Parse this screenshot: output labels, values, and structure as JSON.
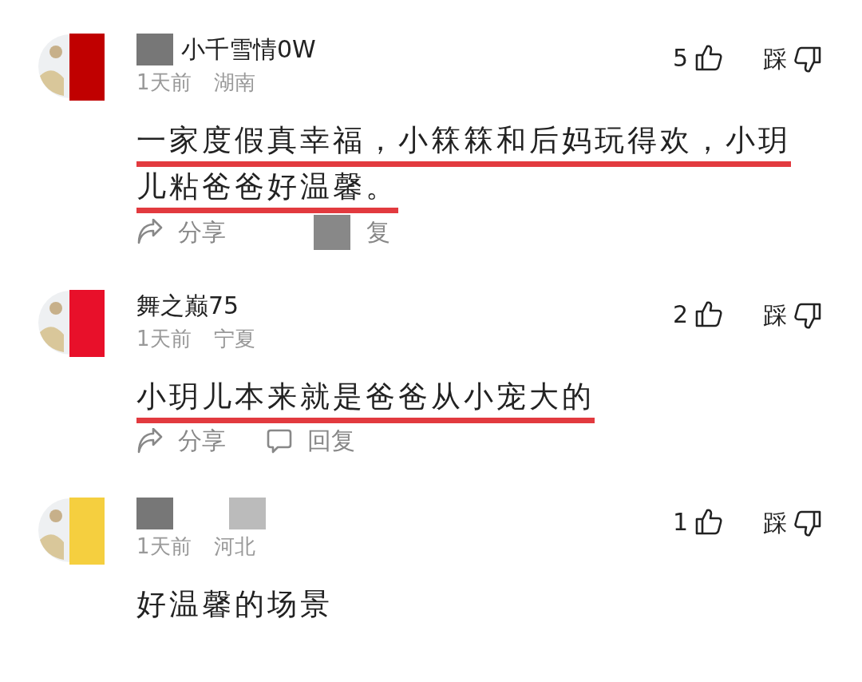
{
  "comments": [
    {
      "avatar": {
        "color": "#c00000"
      },
      "name": "小千雪情0W",
      "name_redacted": true,
      "time": "1天前",
      "region": "湖南",
      "likes": "5",
      "dislike": "踩",
      "text": "一家度假真幸福，小箖箖和后妈玩得欢，小玥儿粘爸爸好温馨。",
      "underlined": true,
      "share": "分享",
      "reply": "复",
      "reply_redacted": true
    },
    {
      "avatar": {
        "color": "#e8102a"
      },
      "name": "舞之巅75",
      "name_redacted": false,
      "time": "1天前",
      "region": "宁夏",
      "likes": "2",
      "dislike": "踩",
      "text": "小玥儿本来就是爸爸从小宠大的",
      "underlined": true,
      "share": "分享",
      "reply": "回复",
      "reply_redacted": false
    },
    {
      "avatar": {
        "color": "#f5cf3f"
      },
      "name_redacted": true,
      "time": "1天前",
      "region": "河北",
      "likes": "1",
      "dislike": "踩",
      "text": "好温馨的场景",
      "underlined": false
    }
  ]
}
